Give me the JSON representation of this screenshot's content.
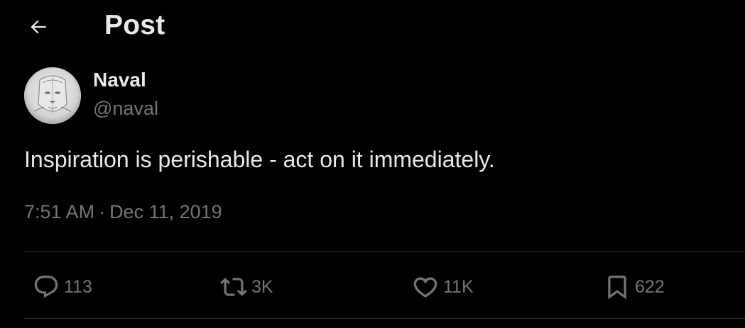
{
  "header": {
    "title": "Post",
    "back_icon": "arrow-left-icon"
  },
  "author": {
    "display_name": "Naval",
    "handle": "@naval",
    "avatar_icon": "avatar-image"
  },
  "post": {
    "text": "Inspiration is perishable - act on it immediately.",
    "time": "7:51 AM",
    "separator": "·",
    "date": "Dec 11, 2019"
  },
  "actions": {
    "reply": {
      "icon": "reply-icon",
      "count": "113"
    },
    "repost": {
      "icon": "repost-icon",
      "count": "3K"
    },
    "like": {
      "icon": "heart-icon",
      "count": "11K"
    },
    "bookmark": {
      "icon": "bookmark-icon",
      "count": "622"
    }
  },
  "colors": {
    "background": "#000000",
    "primary_text": "#e7e9ea",
    "secondary_text": "#71767b",
    "divider": "#2f3336"
  }
}
